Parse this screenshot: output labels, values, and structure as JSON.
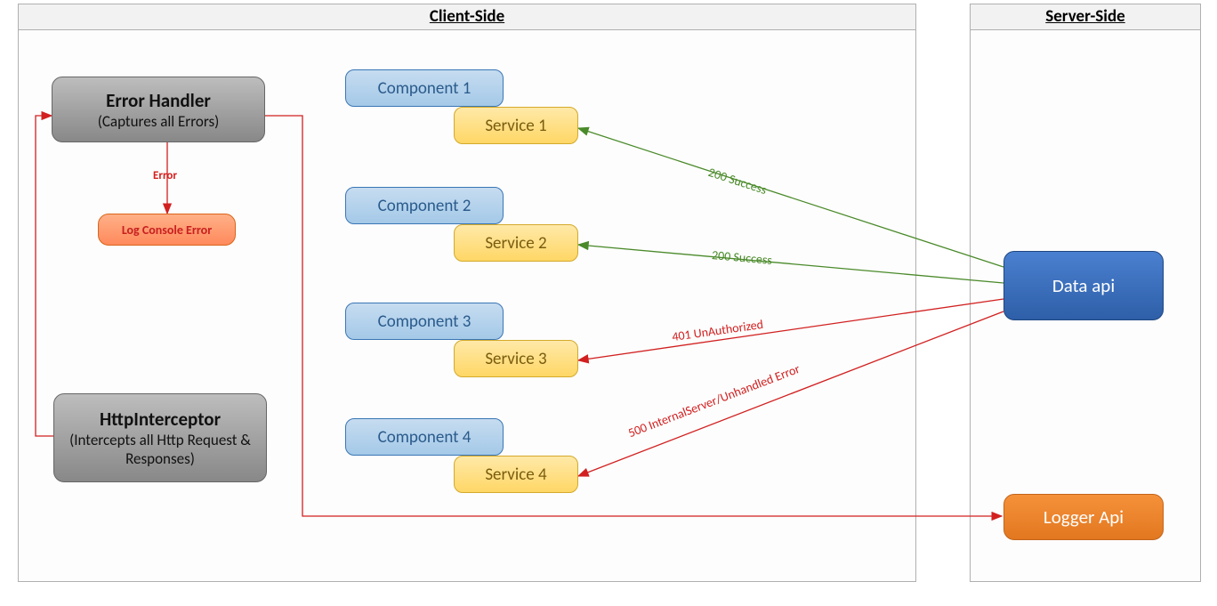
{
  "client": {
    "title": "Client-Side",
    "errorHandler": {
      "title": "Error Handler",
      "subtitle": "(Captures all Errors)"
    },
    "httpInterceptor": {
      "title": "HttpInterceptor",
      "subtitle": "(Intercepts all Http Request & Responses)"
    },
    "logConsole": "Log Console Error",
    "errorEdge": "Error",
    "components": [
      {
        "comp": "Component 1",
        "svc": "Service 1"
      },
      {
        "comp": "Component 2",
        "svc": "Service 2"
      },
      {
        "comp": "Component 3",
        "svc": "Service 3"
      },
      {
        "comp": "Component 4",
        "svc": "Service 4"
      }
    ]
  },
  "server": {
    "title": "Server-Side",
    "dataApi": "Data api",
    "loggerApi": "Logger Api"
  },
  "edges": {
    "s1": "200 Success",
    "s2": "200 Success",
    "s3": "401 UnAuthorized",
    "s4": "500 InternalServer/Unhandled Error"
  }
}
